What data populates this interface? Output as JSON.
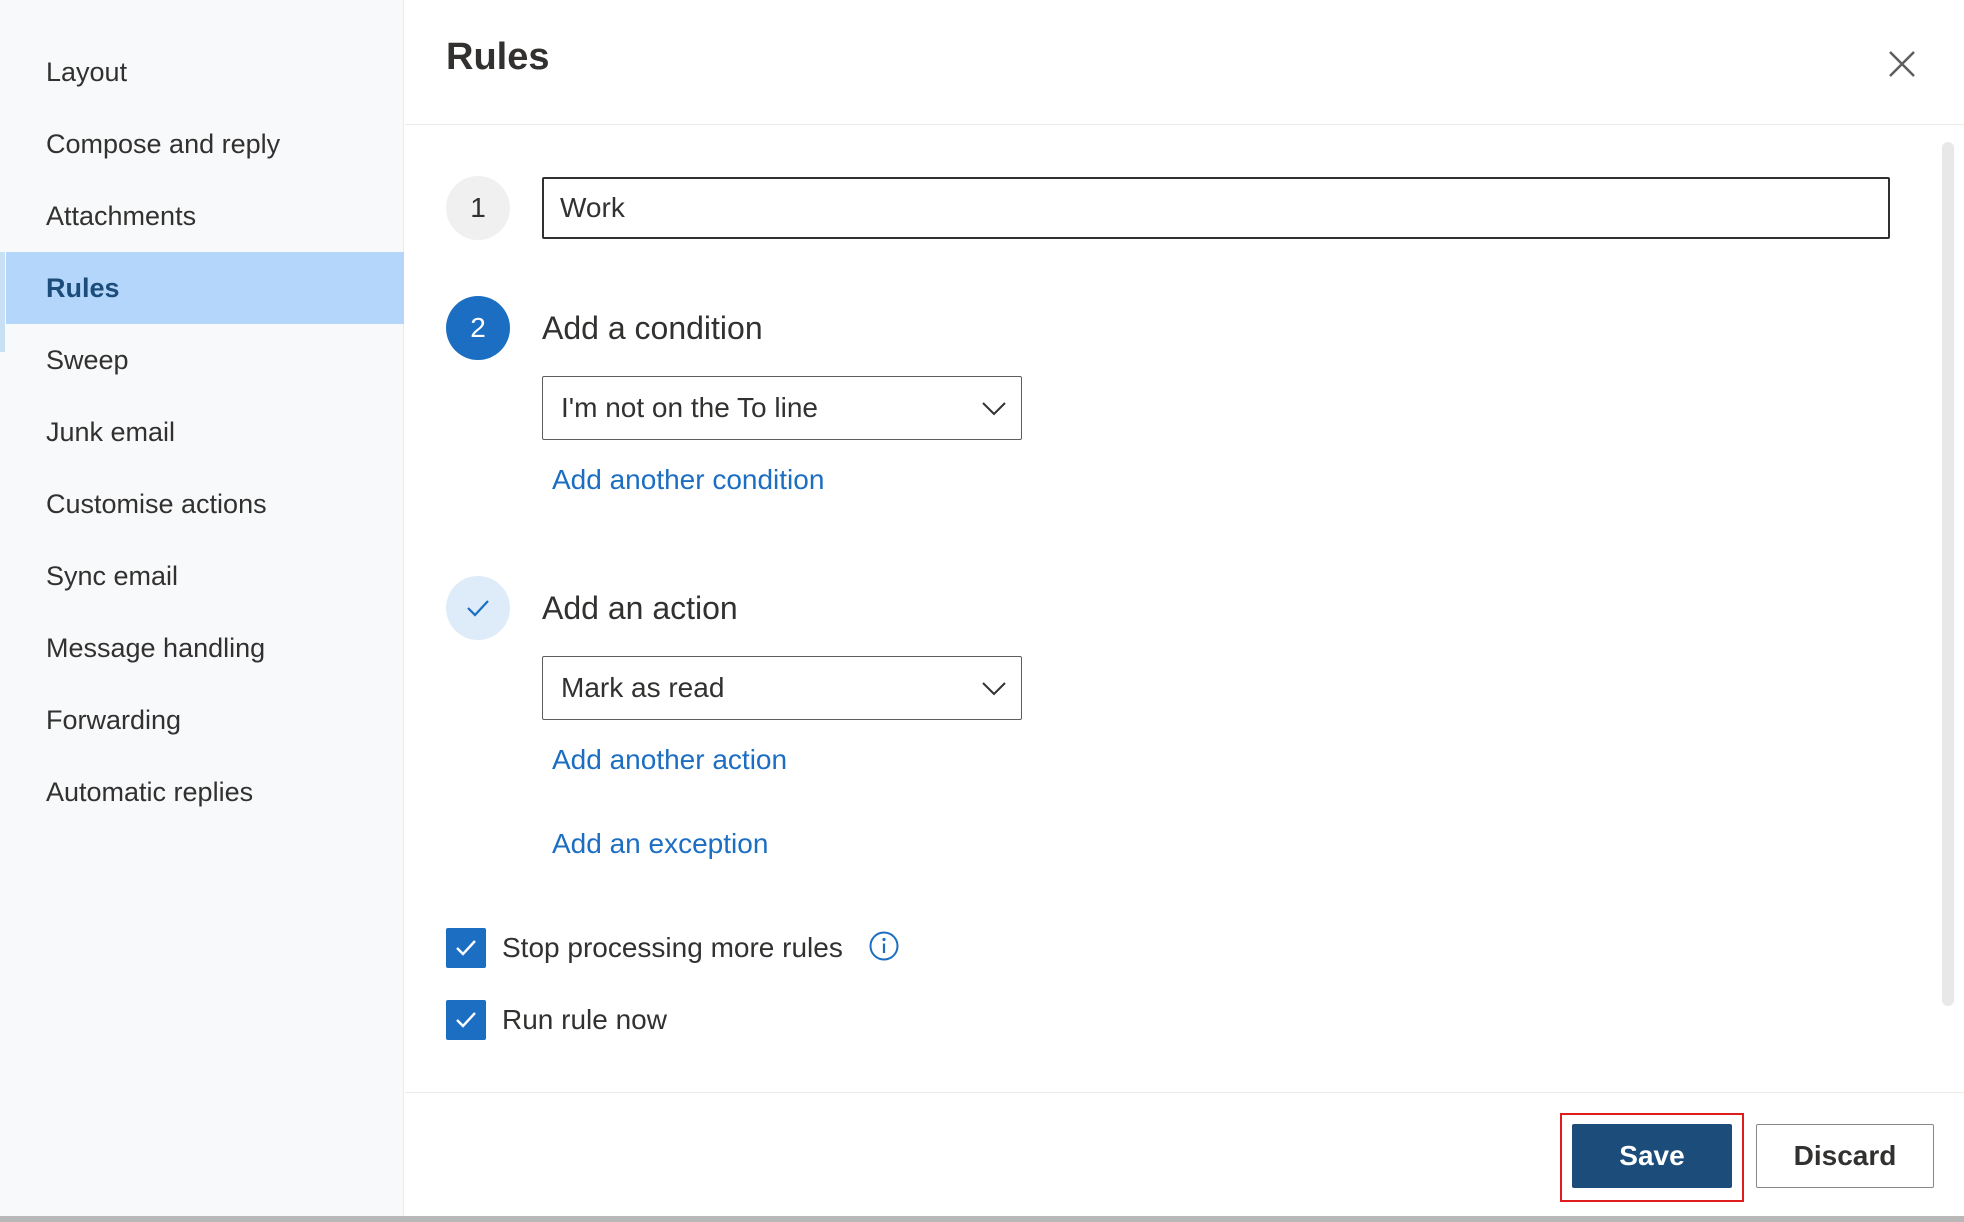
{
  "sidebar": {
    "items": [
      {
        "label": "Layout"
      },
      {
        "label": "Compose and reply"
      },
      {
        "label": "Attachments"
      },
      {
        "label": "Rules",
        "selected": true
      },
      {
        "label": "Sweep"
      },
      {
        "label": "Junk email"
      },
      {
        "label": "Customise actions"
      },
      {
        "label": "Sync email"
      },
      {
        "label": "Message handling"
      },
      {
        "label": "Forwarding"
      },
      {
        "label": "Automatic replies"
      }
    ]
  },
  "header": {
    "title": "Rules",
    "close_icon": "close-icon"
  },
  "rule": {
    "step1_number": "1",
    "name_value": "Work",
    "step2_number": "2",
    "condition_heading": "Add a condition",
    "condition_value": "I'm not on the To line",
    "add_condition_link": "Add another condition",
    "action_heading": "Add an action",
    "action_value": "Mark as read",
    "add_action_link": "Add another action",
    "add_exception_link": "Add an exception",
    "stop_processing_label": "Stop processing more rules",
    "stop_processing_checked": true,
    "run_now_label": "Run rule now",
    "run_now_checked": true
  },
  "footer": {
    "save_label": "Save",
    "discard_label": "Discard"
  },
  "colors": {
    "accent": "#1b6ec2",
    "save_button": "#1b4c7a",
    "selected_nav": "#b3d6fa",
    "highlight_outline": "#e01d1d"
  }
}
